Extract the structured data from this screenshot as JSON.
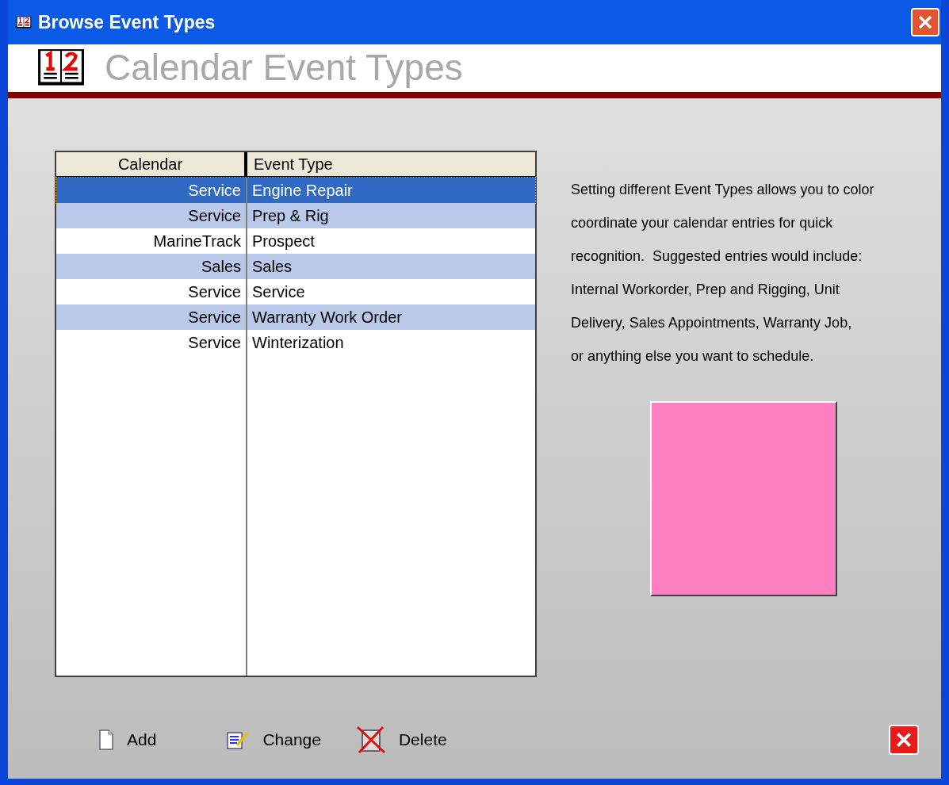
{
  "window": {
    "title": "Browse Event Types"
  },
  "header": {
    "title": "Calendar Event Types"
  },
  "table": {
    "columns": [
      "Calendar",
      "Event Type"
    ],
    "rows": [
      {
        "calendar": "Service",
        "event_type": "Engine Repair",
        "selected": true
      },
      {
        "calendar": "Service",
        "event_type": "Prep & Rig",
        "selected": false
      },
      {
        "calendar": "MarineTrack",
        "event_type": "Prospect",
        "selected": false
      },
      {
        "calendar": "Sales",
        "event_type": "Sales",
        "selected": false
      },
      {
        "calendar": "Service",
        "event_type": "Service",
        "selected": false
      },
      {
        "calendar": "Service",
        "event_type": "Warranty Work Order",
        "selected": false
      },
      {
        "calendar": "Service",
        "event_type": "Winterization",
        "selected": false
      }
    ]
  },
  "description": [
    "Setting different Event Types allows you to color",
    "coordinate your calendar entries for quick",
    "recognition.  Suggested entries would include:",
    "Internal Workorder, Prep and Rigging, Unit",
    "Delivery, Sales Appointments, Warranty Job,",
    "or anything else you want to schedule."
  ],
  "swatch": {
    "color": "#ff80c0"
  },
  "buttons": [
    {
      "kind": "add",
      "label": "Add"
    },
    {
      "kind": "change",
      "label": "Change"
    },
    {
      "kind": "delete",
      "label": "Delete"
    }
  ]
}
